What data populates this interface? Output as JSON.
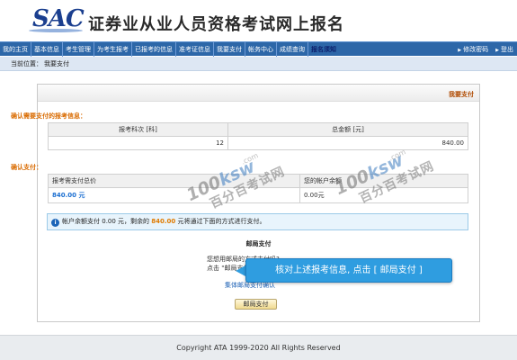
{
  "header": {
    "logo": "SAC",
    "title": "证券业从业人员资格考试网上报名"
  },
  "nav": {
    "items": [
      "我的主页",
      "基本信息",
      "考生管理",
      "为考生报考",
      "已报考的信息",
      "准考证信息",
      "我要支付",
      "帐务中心",
      "成绩查询"
    ],
    "active": "报名须知",
    "right": [
      "修改密码",
      "登出"
    ]
  },
  "breadcrumb": {
    "label": "当前位置：",
    "current": "我要支付"
  },
  "panel": {
    "title": "我要支付",
    "section1_title": "确认需要支付的报考信息：",
    "table1": {
      "headers": [
        "报考科次 [科]",
        "总金额 [元]"
      ],
      "values": [
        "12",
        "840.00"
      ]
    },
    "section2_title": "确认支付：",
    "table2": {
      "headers": [
        "报考需支付总价",
        "您的帐户余额"
      ],
      "values": [
        "840.00 元",
        "0.00元"
      ]
    },
    "notice": {
      "prefix": "帐户余额支付 ",
      "balance": "0.00 元，剩余的 ",
      "remain": "840.00",
      "suffix": " 元将通过下面的方式进行支付。"
    },
    "post": {
      "title": "邮局支付",
      "line1": "您想用邮局的方式支付吗?",
      "line2": "点击 \"邮局支付\"",
      "link": "集体邮局支付确认",
      "button": "邮局支付"
    }
  },
  "tooltip": "核对上述报考信息, 点击 [ 邮局支付 ]",
  "watermark": {
    "logo_a": "100",
    "logo_b": "ksw",
    "com": ".com",
    "site": "百分百考试网"
  },
  "footer": "Copyright ATA 1999-2020 All Rights Reserved"
}
